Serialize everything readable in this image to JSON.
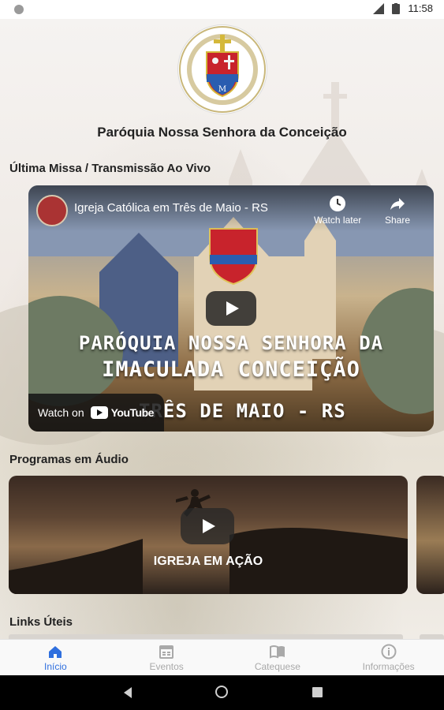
{
  "status_bar": {
    "time": "11:58"
  },
  "parish": {
    "name": "Paróquia Nossa Senhora da Conceição"
  },
  "sections": {
    "live": "Última Missa / Transmissão Ao Vivo",
    "audio": "Programas em Áudio",
    "links": "Links Úteis"
  },
  "video": {
    "title": "Igreja Católica em Três de Maio - RS",
    "watch_later": "Watch later",
    "share": "Share",
    "overlay_line1": "PARÓQUIA NOSSA SENHORA DA",
    "overlay_line2": "IMACULADA CONCEIÇÃO",
    "overlay_line3": "TRÊS DE MAIO - RS",
    "watch_on": "Watch on",
    "youtube": "YouTube"
  },
  "audio_programs": [
    {
      "title": "IGREJA EM AÇÃO"
    }
  ],
  "tabs": [
    {
      "label": "Início",
      "icon": "home-icon",
      "active": true
    },
    {
      "label": "Eventos",
      "icon": "calendar-icon",
      "active": false
    },
    {
      "label": "Catequese",
      "icon": "book-icon",
      "active": false
    },
    {
      "label": "Informações",
      "icon": "info-icon",
      "active": false
    }
  ],
  "colors": {
    "accent": "#2f6fde",
    "inactive_tab": "#a9a9a9"
  }
}
